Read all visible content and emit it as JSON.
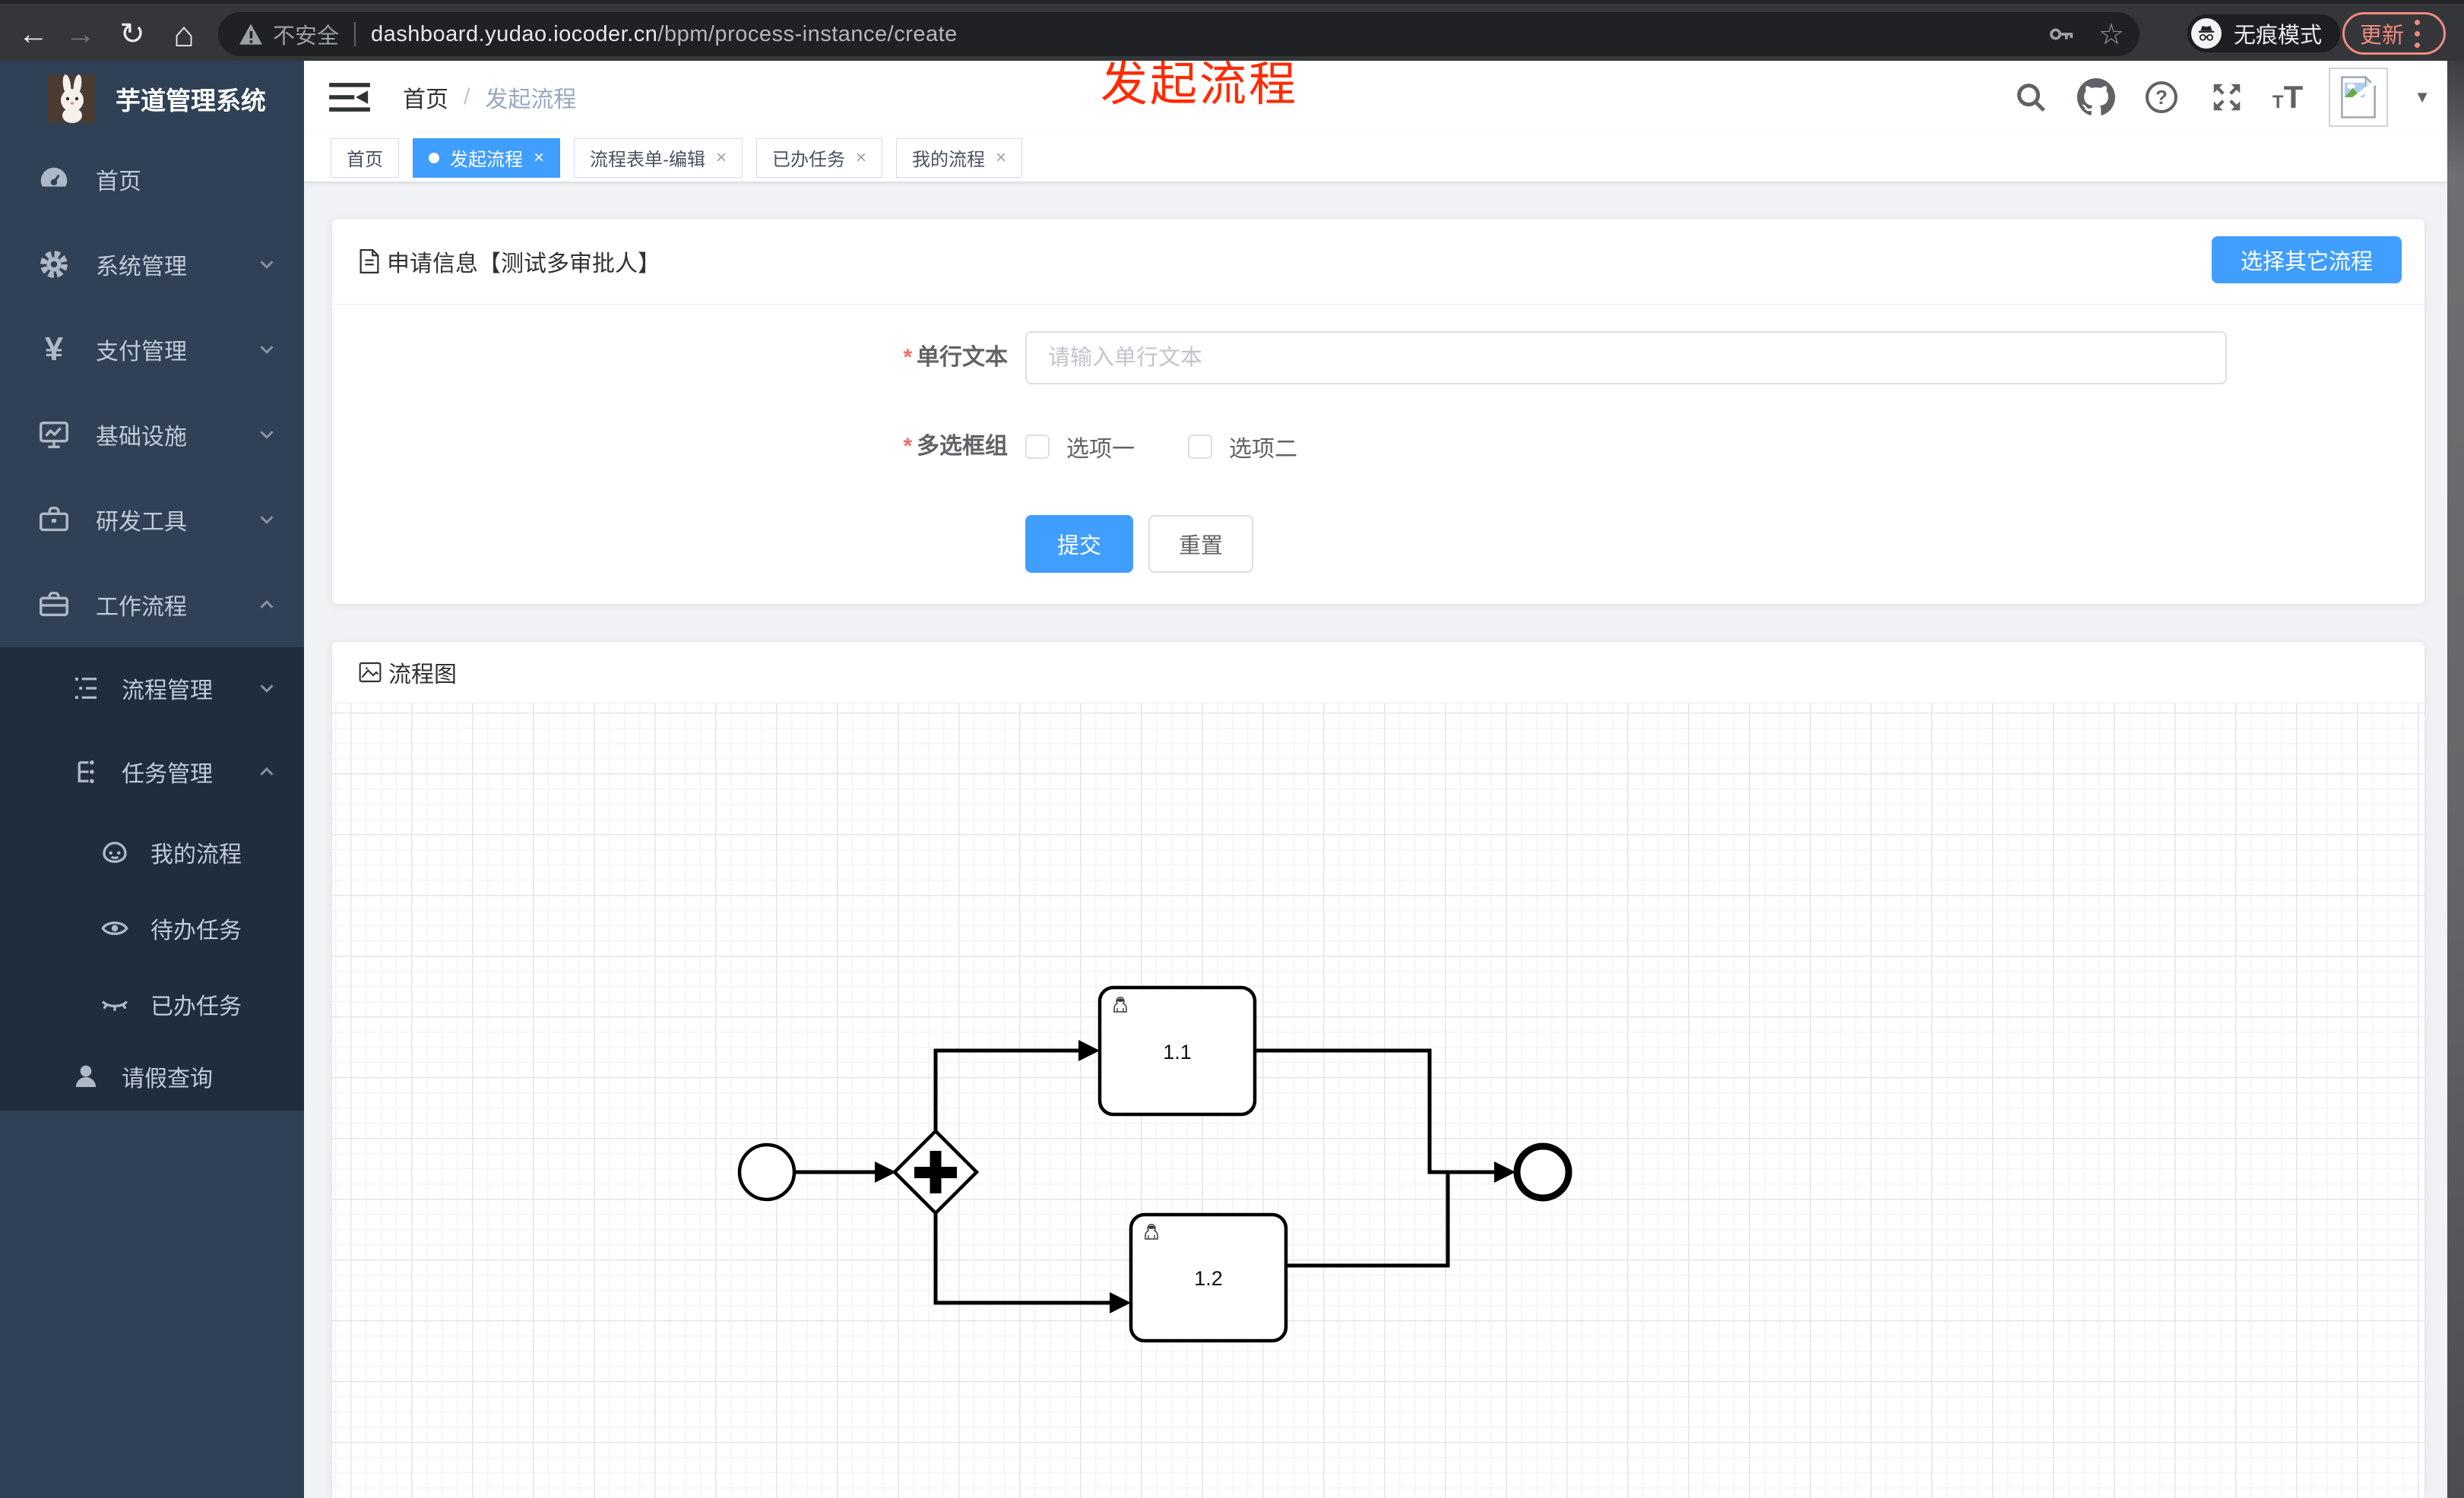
{
  "browser": {
    "security_label": "不安全",
    "url_domain": "dashboard.yudao.iocoder.cn",
    "url_path": "/bpm/process-instance/create",
    "incognito_label": "无痕模式",
    "update_label": "更新"
  },
  "icons": {
    "back": "←",
    "forward": "→",
    "reload": "↻",
    "home": "⌂",
    "star": "☆",
    "caret": "▼",
    "close": "×",
    "help": "?",
    "yen": "¥",
    "required_mark": "*"
  },
  "overlay": {
    "text": "发起流程",
    "color": "#ff2b00"
  },
  "sidebar": {
    "title": "芋道管理系统",
    "items": [
      {
        "label": "首页",
        "icon": "dashboard-icon",
        "state": "none"
      },
      {
        "label": "系统管理",
        "icon": "gear-icon",
        "state": "collapsed"
      },
      {
        "label": "支付管理",
        "icon": "yen-icon",
        "state": "collapsed"
      },
      {
        "label": "基础设施",
        "icon": "monitor-icon",
        "state": "collapsed"
      },
      {
        "label": "研发工具",
        "icon": "toolbox-icon",
        "state": "collapsed"
      },
      {
        "label": "工作流程",
        "icon": "suitcase-icon",
        "state": "expanded"
      }
    ],
    "workflow_children": [
      {
        "label": "流程管理",
        "icon": "list-tree-icon",
        "state": "collapsed"
      },
      {
        "label": "任务管理",
        "icon": "flow-tree-icon",
        "state": "expanded"
      }
    ],
    "task_children": [
      {
        "label": "我的流程",
        "icon": "face-icon"
      },
      {
        "label": "待办任务",
        "icon": "eye-icon"
      },
      {
        "label": "已办任务",
        "icon": "eye-closed-icon"
      }
    ],
    "leave_item": {
      "label": "请假查询",
      "icon": "user-icon"
    }
  },
  "navbar": {
    "breadcrumb": [
      "首页",
      "发起流程"
    ],
    "separator": "/"
  },
  "tabs": [
    {
      "label": "首页",
      "active": false,
      "closable": false
    },
    {
      "label": "发起流程",
      "active": true,
      "closable": true
    },
    {
      "label": "流程表单-编辑",
      "active": false,
      "closable": true
    },
    {
      "label": "已办任务",
      "active": false,
      "closable": true
    },
    {
      "label": "我的流程",
      "active": false,
      "closable": true
    }
  ],
  "form_card": {
    "title": "申请信息【测试多审批人】",
    "select_other_label": "选择其它流程",
    "fields": [
      {
        "label": "单行文本",
        "required": true,
        "type": "text",
        "value": "",
        "placeholder": "请输入单行文本"
      },
      {
        "label": "多选框组",
        "required": true,
        "type": "checkbox-group",
        "options": [
          "选项一",
          "选项二"
        ],
        "checked": [
          false,
          false
        ]
      }
    ],
    "submit_label": "提交",
    "reset_label": "重置"
  },
  "diagram_card": {
    "title": "流程图",
    "bpmn": {
      "start_event": "start",
      "gateway": "parallel-gateway",
      "tasks": [
        {
          "label": "1.1",
          "type": "user-task"
        },
        {
          "label": "1.2",
          "type": "user-task"
        }
      ],
      "end_event": "end"
    }
  },
  "colors": {
    "primary": "#409eff",
    "sidebar_bg": "#304156",
    "submenu_bg": "#1f2d3d",
    "content_bg": "#f0f2f5",
    "danger": "#f56c6c",
    "update_accent": "#ef8b7d",
    "overlay_red": "#ff2b00"
  }
}
